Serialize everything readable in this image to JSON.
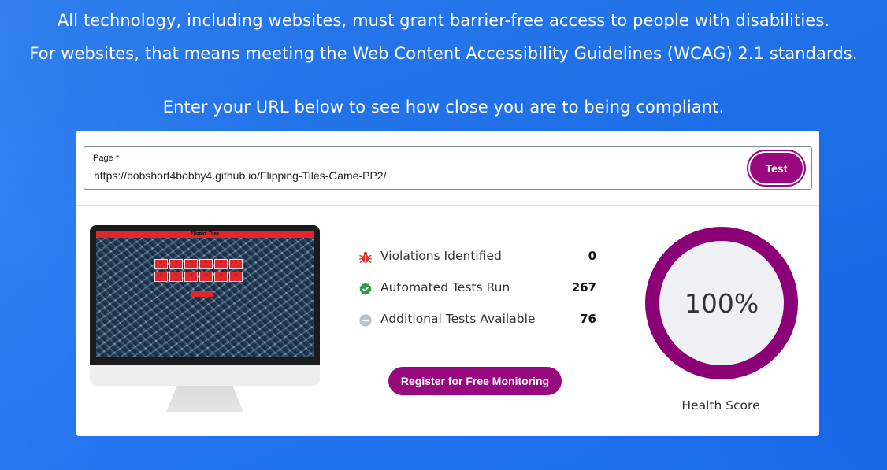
{
  "intro": {
    "line1": "All technology, including websites, must grant barrier-free access to people with disabilities.",
    "line2": "For websites, that means meeting the Web Content Accessibility Guidelines (WCAG) 2.1 standards.",
    "line3": "Enter your URL below to see how close you are to being compliant."
  },
  "form": {
    "page_label": "Page *",
    "url_value": "https://bobshort4bobby4.github.io/Flipping-Tiles-Game-PP2/",
    "test_label": "Test"
  },
  "preview": {
    "site_title": "Flippin' Tiles",
    "tile_glyph": "?"
  },
  "stats": [
    {
      "label": "Violations Identified",
      "value": "0",
      "icon": "bug-icon",
      "color": "#d9342b"
    },
    {
      "label": "Automated Tests Run",
      "value": "267",
      "icon": "check-circle-icon",
      "color": "#2e9b47"
    },
    {
      "label": "Additional Tests Available",
      "value": "76",
      "icon": "minus-circle-icon",
      "color": "#b7c2cc"
    }
  ],
  "register_label": "Register for Free Monitoring",
  "health": {
    "score_text": "100%",
    "score": 100,
    "label": "Health Score",
    "ring_color": "#8b0077",
    "inner_color": "#eef0f4"
  },
  "colors": {
    "background": "#1e73f0",
    "accent": "#98087f"
  }
}
